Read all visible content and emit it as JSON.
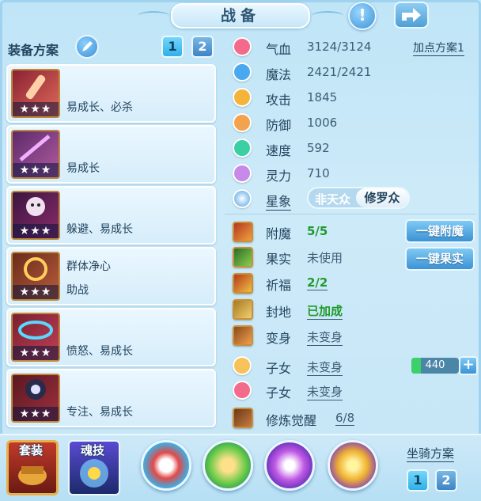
{
  "window": {
    "title": "战备"
  },
  "equip_plan": {
    "title": "装备方案",
    "plans": [
      "1",
      "2"
    ]
  },
  "equipment": [
    {
      "stars": "★★★",
      "traits": [
        "易成长、必杀"
      ]
    },
    {
      "stars": "★★★",
      "traits": [
        "易成长"
      ]
    },
    {
      "stars": "★★★",
      "traits": [
        "躲避、易成长"
      ]
    },
    {
      "stars": "★★★",
      "traits": [
        "群体净心",
        "助战"
      ]
    },
    {
      "stars": "★★★",
      "traits": [
        "愤怒、易成长"
      ]
    },
    {
      "stars": "★★★",
      "traits": [
        "专注、易成长"
      ]
    }
  ],
  "stats": {
    "plan_link": "加点方案1",
    "items": [
      {
        "label": "气血",
        "value": "3124/3124",
        "icon": "heart-icon",
        "color": "#f46a8a"
      },
      {
        "label": "魔法",
        "value": "2421/2421",
        "icon": "mana-drop-icon",
        "color": "#49a9f0"
      },
      {
        "label": "攻击",
        "value": "1845",
        "icon": "sword-icon",
        "color": "#f4b43a"
      },
      {
        "label": "防御",
        "value": "1006",
        "icon": "shield-icon",
        "color": "#f3a24d"
      },
      {
        "label": "速度",
        "value": "592",
        "icon": "lightning-icon",
        "color": "#3ad0a4"
      },
      {
        "label": "灵力",
        "value": "710",
        "icon": "spirit-icon",
        "color": "#c88ae8"
      }
    ],
    "constellation": {
      "label": "星象",
      "options": [
        "非天众",
        "修罗众"
      ],
      "selected": "修罗众"
    }
  },
  "boosts": [
    {
      "label": "附魔",
      "value": "5/5",
      "green": true,
      "underline": false,
      "button": "一键附魔"
    },
    {
      "label": "果实",
      "value": "未使用",
      "green": false,
      "underline": false,
      "button": "一键果实"
    },
    {
      "label": "祈福",
      "value": "2/2",
      "green": true,
      "underline": true
    },
    {
      "label": "封地",
      "value": "已加成",
      "green": true,
      "underline": true
    },
    {
      "label": "变身",
      "value": "未变身",
      "green": false,
      "underline": true
    },
    {
      "label": "子女",
      "value": "未变身",
      "green": false,
      "underline": true
    },
    {
      "label": "子女",
      "value": "未变身",
      "green": false,
      "underline": true
    },
    {
      "label": "修炼觉醒",
      "value": "6/8",
      "green": false,
      "underline": true
    }
  ],
  "child_counter": "440",
  "bottom": {
    "suit_label": "套装",
    "soul_label": "魂技",
    "mount_title": "坐骑方案",
    "mount_plans": [
      "1",
      "2"
    ]
  }
}
